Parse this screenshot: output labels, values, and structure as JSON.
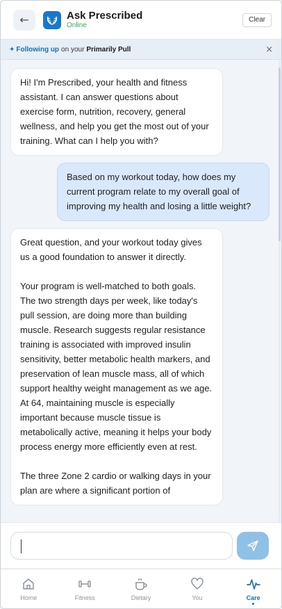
{
  "header": {
    "back_glyph": "←",
    "title": "Ask Prescribed",
    "status": "Online",
    "clear_label": "Clear"
  },
  "context_banner": {
    "spark": "✦",
    "following": "Following up",
    "connector": "on your",
    "program": "Primarily Pull",
    "dismiss_glyph": "×"
  },
  "messages": [
    {
      "role": "assistant",
      "paragraphs": [
        "Hi! I'm Prescribed, your health and fitness assistant. I can answer questions about exercise form, nutrition, recovery, general wellness, and help you get the most out of your training. What can I help you with?"
      ]
    },
    {
      "role": "user",
      "paragraphs": [
        "Based on my workout today, how does my current program relate to my overall goal of improving my health and losing a little weight?"
      ]
    },
    {
      "role": "assistant",
      "paragraphs": [
        "Great question, and your workout today gives us a good foundation to answer it directly.",
        "Your program is well-matched to both goals. The two strength days per week, like today's pull session, are doing more than building muscle. Research suggests regular resistance training is associated with improved insulin sensitivity, better metabolic health markers, and preservation of lean muscle mass, all of which support healthy weight management as we age. At 64, maintaining muscle is especially important because muscle tissue is metabolically active, meaning it helps your body process energy more efficiently even at rest.",
        "The three Zone 2 cardio or walking days in your plan are where a significant portion of"
      ]
    }
  ],
  "input": {
    "placeholder": "",
    "value": ""
  },
  "nav": [
    {
      "label": "Home",
      "icon": "home-icon",
      "active": false
    },
    {
      "label": "Fitness",
      "icon": "dumbbell-icon",
      "active": false
    },
    {
      "label": "Dietary",
      "icon": "cup-icon",
      "active": false
    },
    {
      "label": "You",
      "icon": "heart-icon",
      "active": false
    },
    {
      "label": "Care",
      "icon": "pulse-icon",
      "active": true
    }
  ],
  "colors": {
    "brand": "#1a78c8",
    "online": "#2db352",
    "user_bubble": "#d9e8fb",
    "send_button": "#8fc0e6",
    "active_nav": "#1a6fb8"
  }
}
